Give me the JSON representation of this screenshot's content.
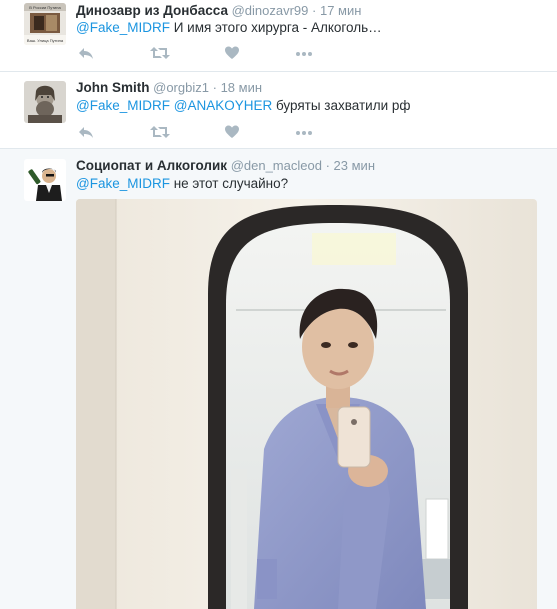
{
  "tweets": [
    {
      "fullname": "Динозавр из Донбасса",
      "username": "@dinozavr99",
      "separator": "·",
      "time": "17 мин",
      "avatar_text_top": "В России Путина",
      "avatar_text_bottom": "Ваш. Улица Путина",
      "text_parts": [
        {
          "text": "@Fake_MIDRF",
          "mention": true
        },
        {
          "text": " И имя этого хирурга - Алкоголь…",
          "mention": false
        }
      ]
    },
    {
      "fullname": "John Smith",
      "username": "@orgbiz1",
      "separator": "·",
      "time": "18 мин",
      "text_parts": [
        {
          "text": "@Fake_MIDRF",
          "mention": true
        },
        {
          "text": " ",
          "mention": false
        },
        {
          "text": "@ANAKOYHER",
          "mention": true
        },
        {
          "text": " буряты захватили рф",
          "mention": false
        }
      ]
    },
    {
      "fullname": "Социопат и Алкоголик",
      "username": "@den_macleod",
      "separator": "·",
      "time": "23 мин",
      "text_parts": [
        {
          "text": "@Fake_MIDRF",
          "mention": true
        },
        {
          "text": " не этот случайно?",
          "mention": false
        }
      ]
    }
  ],
  "actions": {
    "reply_icon": "reply-icon",
    "retweet_icon": "retweet-icon",
    "like_icon": "heart-icon",
    "more_icon": "more-dots-icon"
  },
  "colors": {
    "link": "#1b95e0",
    "meta": "#8899a6",
    "action_icon": "#aab8c2",
    "text": "#292f33"
  }
}
